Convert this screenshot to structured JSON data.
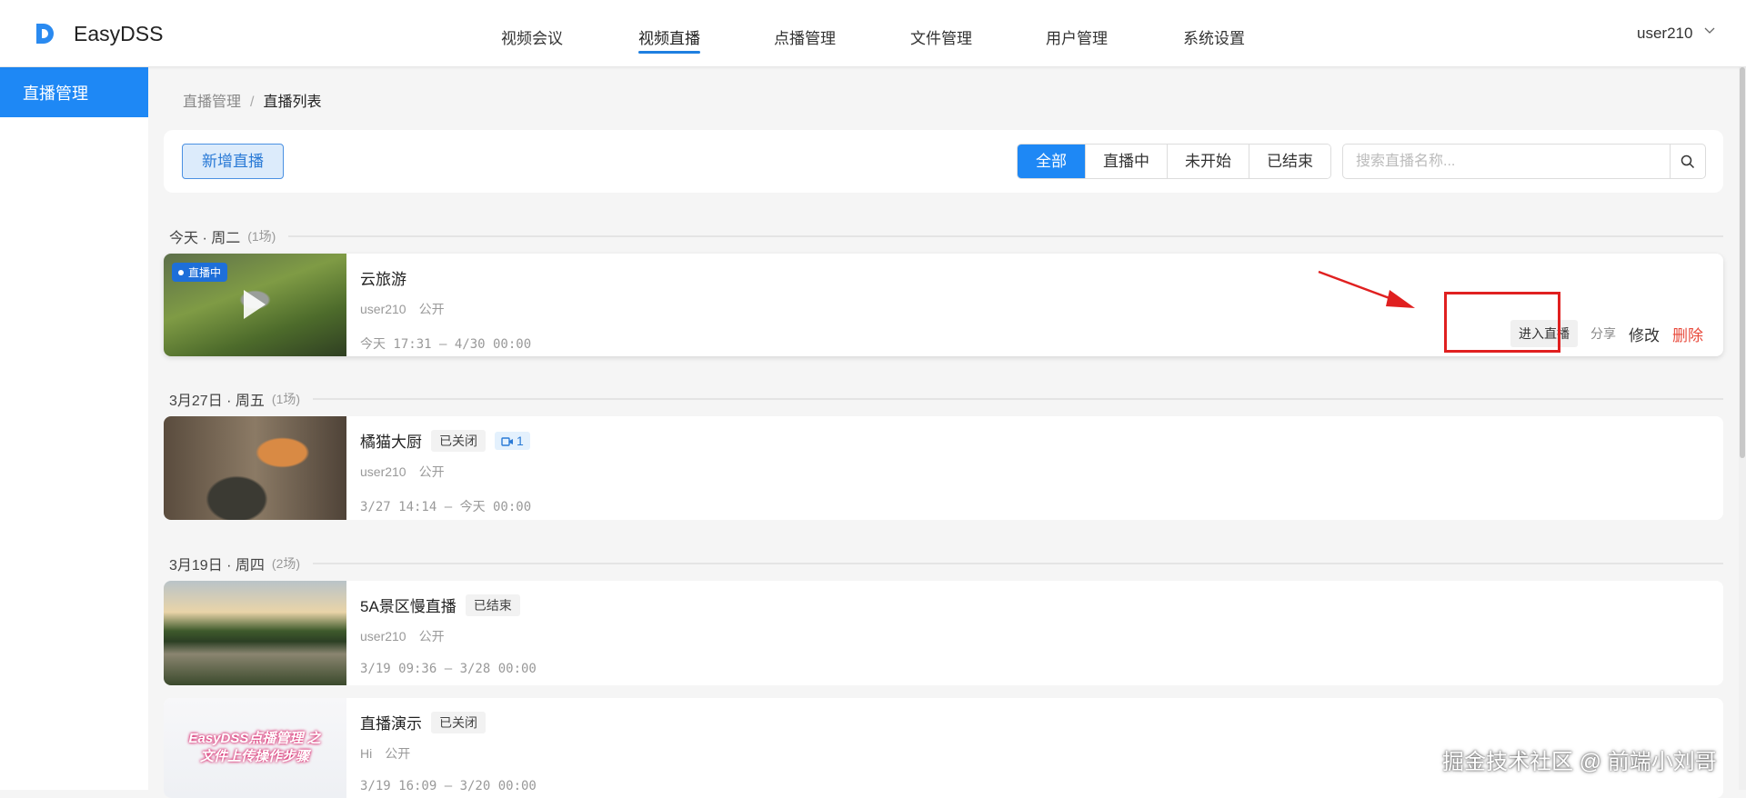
{
  "header": {
    "brand": "EasyDSS",
    "nav": [
      "视频会议",
      "视频直播",
      "点播管理",
      "文件管理",
      "用户管理",
      "系统设置"
    ],
    "active_nav": 1,
    "user": "user210"
  },
  "sidebar": {
    "items": [
      {
        "label": "直播管理",
        "active": true
      }
    ]
  },
  "breadcrumb": {
    "parent": "直播管理",
    "separator": "/",
    "current": "直播列表"
  },
  "toolbar": {
    "new_label": "新增直播",
    "filters": [
      "全部",
      "直播中",
      "未开始",
      "已结束"
    ],
    "active_filter": 0,
    "search_placeholder": "搜索直播名称..."
  },
  "groups": [
    {
      "label": "今天 · 周二",
      "count": "(1场)",
      "items": [
        {
          "title": "云旅游",
          "live_badge": "直播中",
          "owner": "user210",
          "visibility": "公开",
          "time": "今天 17:31 – 4/30 00:00",
          "actions": {
            "enter": "进入直播",
            "share": "分享",
            "edit": "修改",
            "delete": "删除"
          }
        }
      ]
    },
    {
      "label": "3月27日 · 周五",
      "count": "(1场)",
      "items": [
        {
          "title": "橘猫大厨",
          "status": "已关闭",
          "camera_count": "1",
          "owner": "user210",
          "visibility": "公开",
          "time": "3/27 14:14 – 今天 00:00"
        }
      ]
    },
    {
      "label": "3月19日 · 周四",
      "count": "(2场)",
      "items": [
        {
          "title": "5A景区慢直播",
          "status": "已结束",
          "owner": "user210",
          "visibility": "公开",
          "time": "3/19 09:36 – 3/28 00:00"
        },
        {
          "title": "直播演示",
          "status": "已关闭",
          "owner": "Hi",
          "visibility": "公开",
          "time": "3/19 16:09 – 3/20 00:00",
          "thumb_text": "EasyDSS点播管理 之文件上传操作步骤"
        }
      ]
    }
  ],
  "watermark": "掘金技术社区 @ 前端小刘哥",
  "colors": {
    "primary": "#1e88f5",
    "danger": "#e84a3c",
    "annotation": "#e02020"
  }
}
